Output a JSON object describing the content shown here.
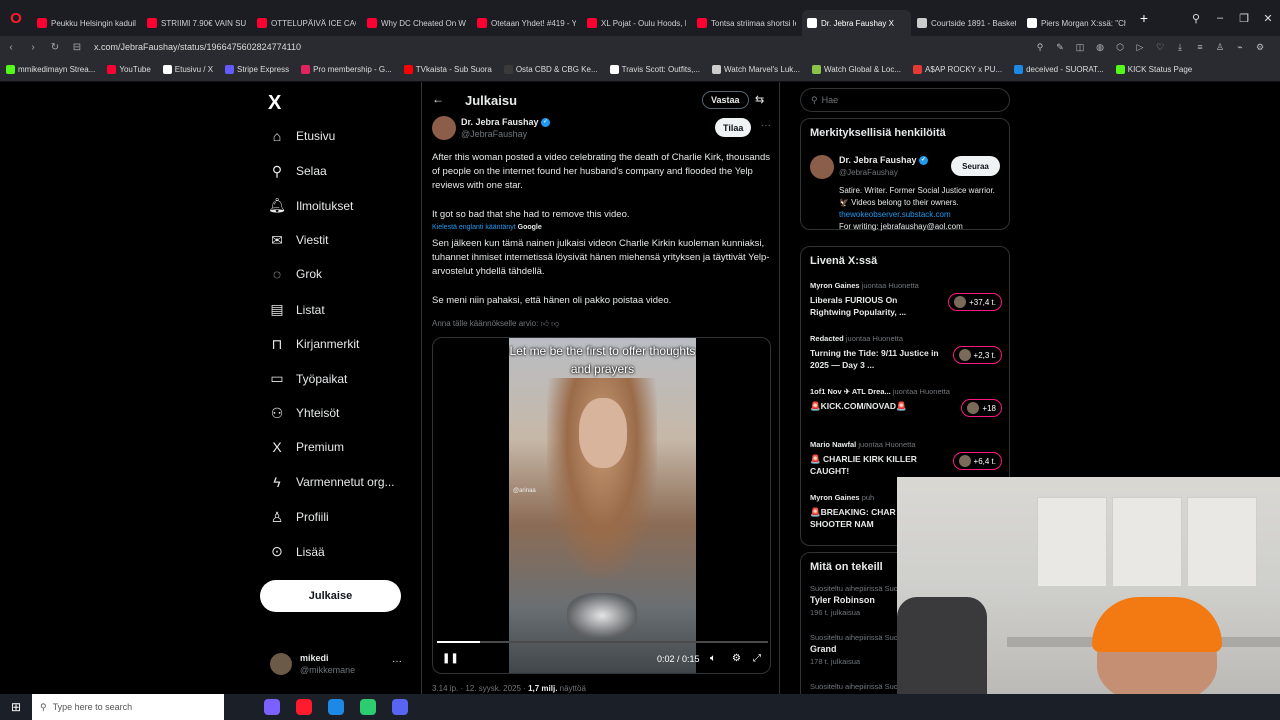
{
  "browser": {
    "tabs": [
      {
        "title": "Peukku Helsingin kaduill",
        "color": "#ff0033"
      },
      {
        "title": "STRIIMI 7.90€ VAIN SUNN",
        "color": "#ff0033"
      },
      {
        "title": "OTTELUPÄIVÄ ICE CAGE 5",
        "color": "#ff0033"
      },
      {
        "title": "Why DC Cheated On Wei",
        "color": "#ff0033"
      },
      {
        "title": "Otetaan Yhdet! #419 - Yo",
        "color": "#ff0033"
      },
      {
        "title": "XL Pojat - Oulu Hoods, N",
        "color": "#ff0033"
      },
      {
        "title": "Tontsa striimaa shortsi le",
        "color": "#ff0033"
      },
      {
        "title": "Dr. Jebra Faushay X",
        "color": "#ffffff"
      },
      {
        "title": "Courtside 1891 - Basketb",
        "color": "#cccccc"
      },
      {
        "title": "Piers Morgan X:ssä: \"Cha",
        "color": "#ffffff"
      }
    ],
    "active_tab": 7,
    "url": "x.com/JebraFaushay/status/1966475602824774110",
    "bookmarks": [
      {
        "label": "mmikedimayn Strea...",
        "color": "#53fc18"
      },
      {
        "label": "YouTube",
        "color": "#ff0033"
      },
      {
        "label": "Etusivu / X",
        "color": "#ffffff"
      },
      {
        "label": "Stripe Express",
        "color": "#635bff"
      },
      {
        "label": "Pro membership - G...",
        "color": "#e0245e"
      },
      {
        "label": "TVkaista - Sub Suora",
        "color": "#ff0000"
      },
      {
        "label": "Osta CBD & CBG Ke...",
        "color": "#3a3a3a"
      },
      {
        "label": "Travis Scott: Outfits,...",
        "color": "#ffffff"
      },
      {
        "label": "Watch Marvel's Luk...",
        "color": "#cccccc"
      },
      {
        "label": "Watch Global & Loc...",
        "color": "#8bc34a"
      },
      {
        "label": "A$AP ROCKY x PU...",
        "color": "#e53935"
      },
      {
        "label": "deceived - SUORAT...",
        "color": "#1e88e5"
      },
      {
        "label": "KICK Status Page",
        "color": "#53fc18"
      }
    ]
  },
  "nav": {
    "items": [
      {
        "label": "Etusivu",
        "icon": "⌂",
        "name": "home-icon"
      },
      {
        "label": "Selaa",
        "icon": "⚲",
        "name": "search-icon"
      },
      {
        "label": "Ilmoitukset",
        "icon": "🔔︎",
        "name": "bell-icon"
      },
      {
        "label": "Viestit",
        "icon": "✉",
        "name": "mail-icon"
      },
      {
        "label": "Grok",
        "icon": "◌",
        "name": "grok-icon"
      },
      {
        "label": "Listat",
        "icon": "▤",
        "name": "list-icon"
      },
      {
        "label": "Kirjanmerkit",
        "icon": "⊓",
        "name": "bookmark-icon"
      },
      {
        "label": "Työpaikat",
        "icon": "▭",
        "name": "briefcase-icon"
      },
      {
        "label": "Yhteisöt",
        "icon": "⚇",
        "name": "communities-icon"
      },
      {
        "label": "Premium",
        "icon": "X",
        "name": "premium-icon"
      },
      {
        "label": "Varmennetut org...",
        "icon": "ϟ",
        "name": "lightning-icon"
      },
      {
        "label": "Profiili",
        "icon": "♙",
        "name": "profile-icon"
      },
      {
        "label": "Lisää",
        "icon": "⊙",
        "name": "more-icon"
      }
    ],
    "post_label": "Julkaise",
    "user_name": "mikedi",
    "user_handle": "@mikkemane"
  },
  "post": {
    "header": "Julkaisu",
    "reply_label": "Vastaa",
    "author_name": "Dr. Jebra Faushay",
    "author_handle": "@JebraFaushay",
    "subscribe_label": "Tilaa",
    "text_en_1": "After this woman posted a video celebrating the death of Charlie Kirk, thousands of people on the internet found her husband's company and flooded the Yelp reviews with one star.",
    "text_en_2": "It got so bad that she had to remove this video.",
    "translated_label": "Kielestä englanti kääntänyt",
    "translated_by": "Google",
    "text_fi_1": "Sen jälkeen kun tämä nainen julkaisi videon Charlie Kirkin kuoleman kunniaksi, tuhannet ihmiset internetissä löysivät hänen miehensä yrityksen ja täyttivät Yelp-arvostelut yhdellä tähdellä.",
    "text_fi_2": "Se meni niin pahaksi, että hänen oli pakko poistaa video.",
    "rate_label": "Anna tälle käännökselle arvio:",
    "video_caption": "Let me be the first to offer thoughts and prayers",
    "video_watermark": "@arinaa",
    "video_time": "0:02 / 0:15",
    "video_progress": 0.13,
    "meta_time": "3.14 ip. · 12. syysk. 2025 ·",
    "meta_views": "1,7 milj.",
    "meta_views_label": "näyttöä"
  },
  "sidebar": {
    "search_placeholder": "Hae",
    "relevant_title": "Merkityksellisiä henkilöitä",
    "rel_name": "Dr. Jebra Faushay",
    "rel_handle": "@JebraFaushay",
    "follow_label": "Seuraa",
    "bio_1": "Satire. Writer. Former Social Justice warrior. 🦅 Videos belong to their owners.",
    "bio_link": "thewokeobserver.substack.com",
    "bio_2": "For writing: jebrafaushay@aol.com",
    "live_title": "Livenä X:ssä",
    "live": [
      {
        "host": "Myron Gaines",
        "suffix": "juontaa Huonetta",
        "title": "Liberals FURIOUS On Rightwing Popularity, ...",
        "badge": "+37,4 t."
      },
      {
        "host": "Redacted",
        "suffix": "juontaa Huonetta",
        "title": "Turning the Tide: 9/11 Justice in 2025 — Day 3 ...",
        "badge": "+2,3 t."
      },
      {
        "host": "1of1 Nov ✈ ATL Drea...",
        "suffix": "juontaa Huonetta",
        "title": "🚨KICK.COM/NOVAD🚨",
        "badge": "+18"
      },
      {
        "host": "Mario Nawfal",
        "suffix": "juontaa Huonetta",
        "title": "🚨 CHARLIE KIRK KILLER CAUGHT!",
        "badge": "+6,4 t."
      },
      {
        "host": "Myron Gaines",
        "suffix": "puh",
        "title": "🚨BREAKING: CHAR KIRK SHOOTER NAM",
        "badge": ""
      }
    ],
    "trends_title": "Mitä on tekeill",
    "trends": [
      {
        "context": "Suositeltu aihepiirissä Suo",
        "name": "Tyler Robinson",
        "count": "196 t. julkaisua"
      },
      {
        "context": "Suositeltu aihepiirissä Suo",
        "name": "Grand",
        "count": "178 t. julkaisua"
      },
      {
        "context": "Suositeltu aihepiirissä Suo",
        "name": "",
        "count": ""
      }
    ]
  },
  "taskbar": {
    "search_placeholder": "Type here to search",
    "apps": [
      {
        "name": "task-view-icon",
        "color": "#1b1f27"
      },
      {
        "name": "copilot-icon",
        "color": "#7b61ff"
      },
      {
        "name": "opera-icon",
        "color": "#ff1b2d"
      },
      {
        "name": "edge-icon",
        "color": "#1e88e5"
      },
      {
        "name": "app-icon",
        "color": "#2ecc71"
      },
      {
        "name": "discord-icon",
        "color": "#5865f2"
      }
    ]
  }
}
